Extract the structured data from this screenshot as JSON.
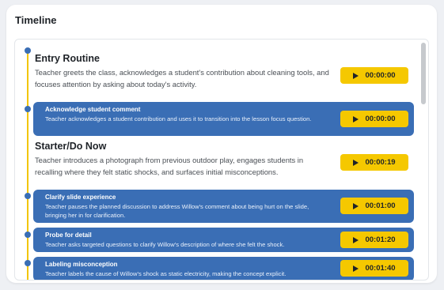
{
  "panel": {
    "title": "Timeline"
  },
  "timeline": {
    "items": [
      {
        "kind": "section",
        "title": "Entry Routine",
        "description": "Teacher greets the class, acknowledges a student's contribution about cleaning tools, and focuses attention by asking about today's activity.",
        "timestamp": "00:00:00"
      },
      {
        "kind": "event",
        "title": "Acknowledge student comment",
        "description": "Teacher acknowledges a student contribution and uses it to transition into the lesson focus question.",
        "timestamp": "00:00:00"
      },
      {
        "kind": "section",
        "title": "Starter/Do Now",
        "description": "Teacher introduces a photograph from previous outdoor play, engages students in recalling where they felt static shocks, and surfaces initial misconceptions.",
        "timestamp": "00:00:19"
      },
      {
        "kind": "event",
        "title": "Clarify slide experience",
        "description": "Teacher pauses the planned discussion to address Willow's comment about being hurt on the slide, bringing her in for clarification.",
        "timestamp": "00:01:00"
      },
      {
        "kind": "event",
        "title": "Probe for detail",
        "description": "Teacher asks targeted questions to clarify Willow's description of where she felt the shock.",
        "timestamp": "00:01:20"
      },
      {
        "kind": "event",
        "title": "Labeling misconception",
        "description": "Teacher labels the cause of Willow's shock as static electricity, making the concept explicit.",
        "timestamp": "00:01:40"
      }
    ]
  },
  "colors": {
    "event_bg": "#3a6eb5",
    "timeline_line": "#f2c500",
    "timestamp_button": "#f5c800"
  },
  "icons": {
    "timestamp_button": "play-icon"
  }
}
